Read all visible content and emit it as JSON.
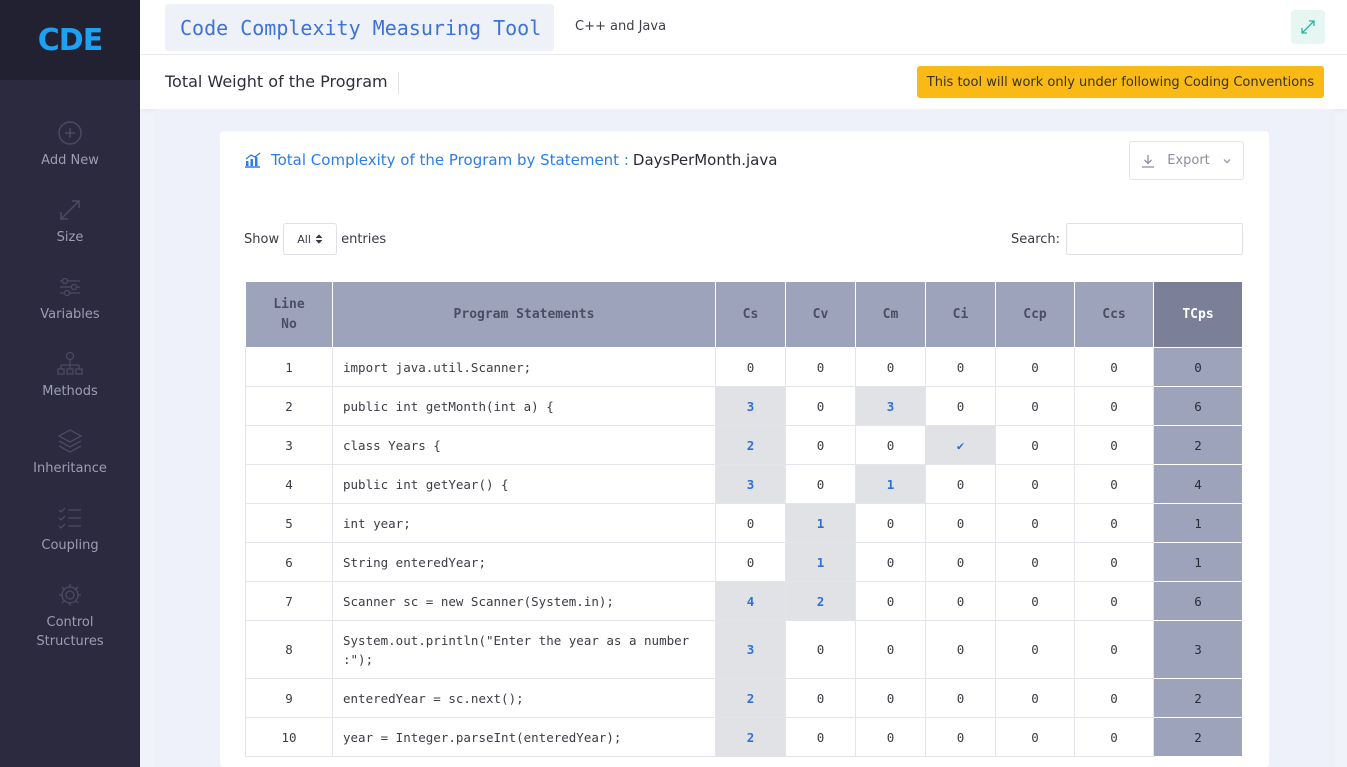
{
  "app": {
    "logo": "CDE",
    "title": "Code Complexity Measuring Tool",
    "subtitle": "C++ and Java"
  },
  "sidebar": {
    "items": [
      {
        "label": "Add New",
        "icon": "plus-circle-icon"
      },
      {
        "label": "Size",
        "icon": "expand-icon"
      },
      {
        "label": "Variables",
        "icon": "sliders-icon"
      },
      {
        "label": "Methods",
        "icon": "hierarchy-icon"
      },
      {
        "label": "Inheritance",
        "icon": "layers-icon"
      },
      {
        "label": "Coupling",
        "icon": "checklist-icon"
      },
      {
        "label": "Control Structures",
        "icon": "gear-icon"
      }
    ]
  },
  "subheader": {
    "title": "Total Weight of the Program",
    "warning": "This tool will work only under following Coding Conventions"
  },
  "card": {
    "title_prefix": "Total Complexity of the Program by Statement :",
    "file_name": "DaysPerMonth.java",
    "export_label": "Export",
    "show_label": "Show",
    "entries_value": "All",
    "entries_label": "entries",
    "search_label": "Search:",
    "search_value": ""
  },
  "table": {
    "headers": [
      "Line No",
      "Program Statements",
      "Cs",
      "Cv",
      "Cm",
      "Ci",
      "Ccp",
      "Ccs",
      "TCps"
    ],
    "rows": [
      {
        "line": "1",
        "stmt": "import java.util.Scanner;",
        "cs": "0",
        "cv": "0",
        "cm": "0",
        "ci": "0",
        "ccp": "0",
        "ccs": "0",
        "tcps": "0"
      },
      {
        "line": "2",
        "stmt": "public int getMonth(int a) {",
        "cs": "3",
        "cv": "0",
        "cm": "3",
        "ci": "0",
        "ccp": "0",
        "ccs": "0",
        "tcps": "6"
      },
      {
        "line": "3",
        "stmt": "class Years {",
        "cs": "2",
        "cv": "0",
        "cm": "0",
        "ci": "✔",
        "ccp": "0",
        "ccs": "0",
        "tcps": "2"
      },
      {
        "line": "4",
        "stmt": "public int getYear() {",
        "cs": "3",
        "cv": "0",
        "cm": "1",
        "ci": "0",
        "ccp": "0",
        "ccs": "0",
        "tcps": "4"
      },
      {
        "line": "5",
        "stmt": "int year;",
        "cs": "0",
        "cv": "1",
        "cm": "0",
        "ci": "0",
        "ccp": "0",
        "ccs": "0",
        "tcps": "1"
      },
      {
        "line": "6",
        "stmt": "String enteredYear;",
        "cs": "0",
        "cv": "1",
        "cm": "0",
        "ci": "0",
        "ccp": "0",
        "ccs": "0",
        "tcps": "1"
      },
      {
        "line": "7",
        "stmt": "Scanner sc = new Scanner(System.in);",
        "cs": "4",
        "cv": "2",
        "cm": "0",
        "ci": "0",
        "ccp": "0",
        "ccs": "0",
        "tcps": "6"
      },
      {
        "line": "8",
        "stmt": "System.out.println(\"Enter the year as a number :\");",
        "cs": "3",
        "cv": "0",
        "cm": "0",
        "ci": "0",
        "ccp": "0",
        "ccs": "0",
        "tcps": "3"
      },
      {
        "line": "9",
        "stmt": "enteredYear = sc.next();",
        "cs": "2",
        "cv": "0",
        "cm": "0",
        "ci": "0",
        "ccp": "0",
        "ccs": "0",
        "tcps": "2"
      },
      {
        "line": "10",
        "stmt": "year = Integer.parseInt(enteredYear);",
        "cs": "2",
        "cv": "0",
        "cm": "0",
        "ci": "0",
        "ccp": "0",
        "ccs": "0",
        "tcps": "2"
      }
    ]
  }
}
